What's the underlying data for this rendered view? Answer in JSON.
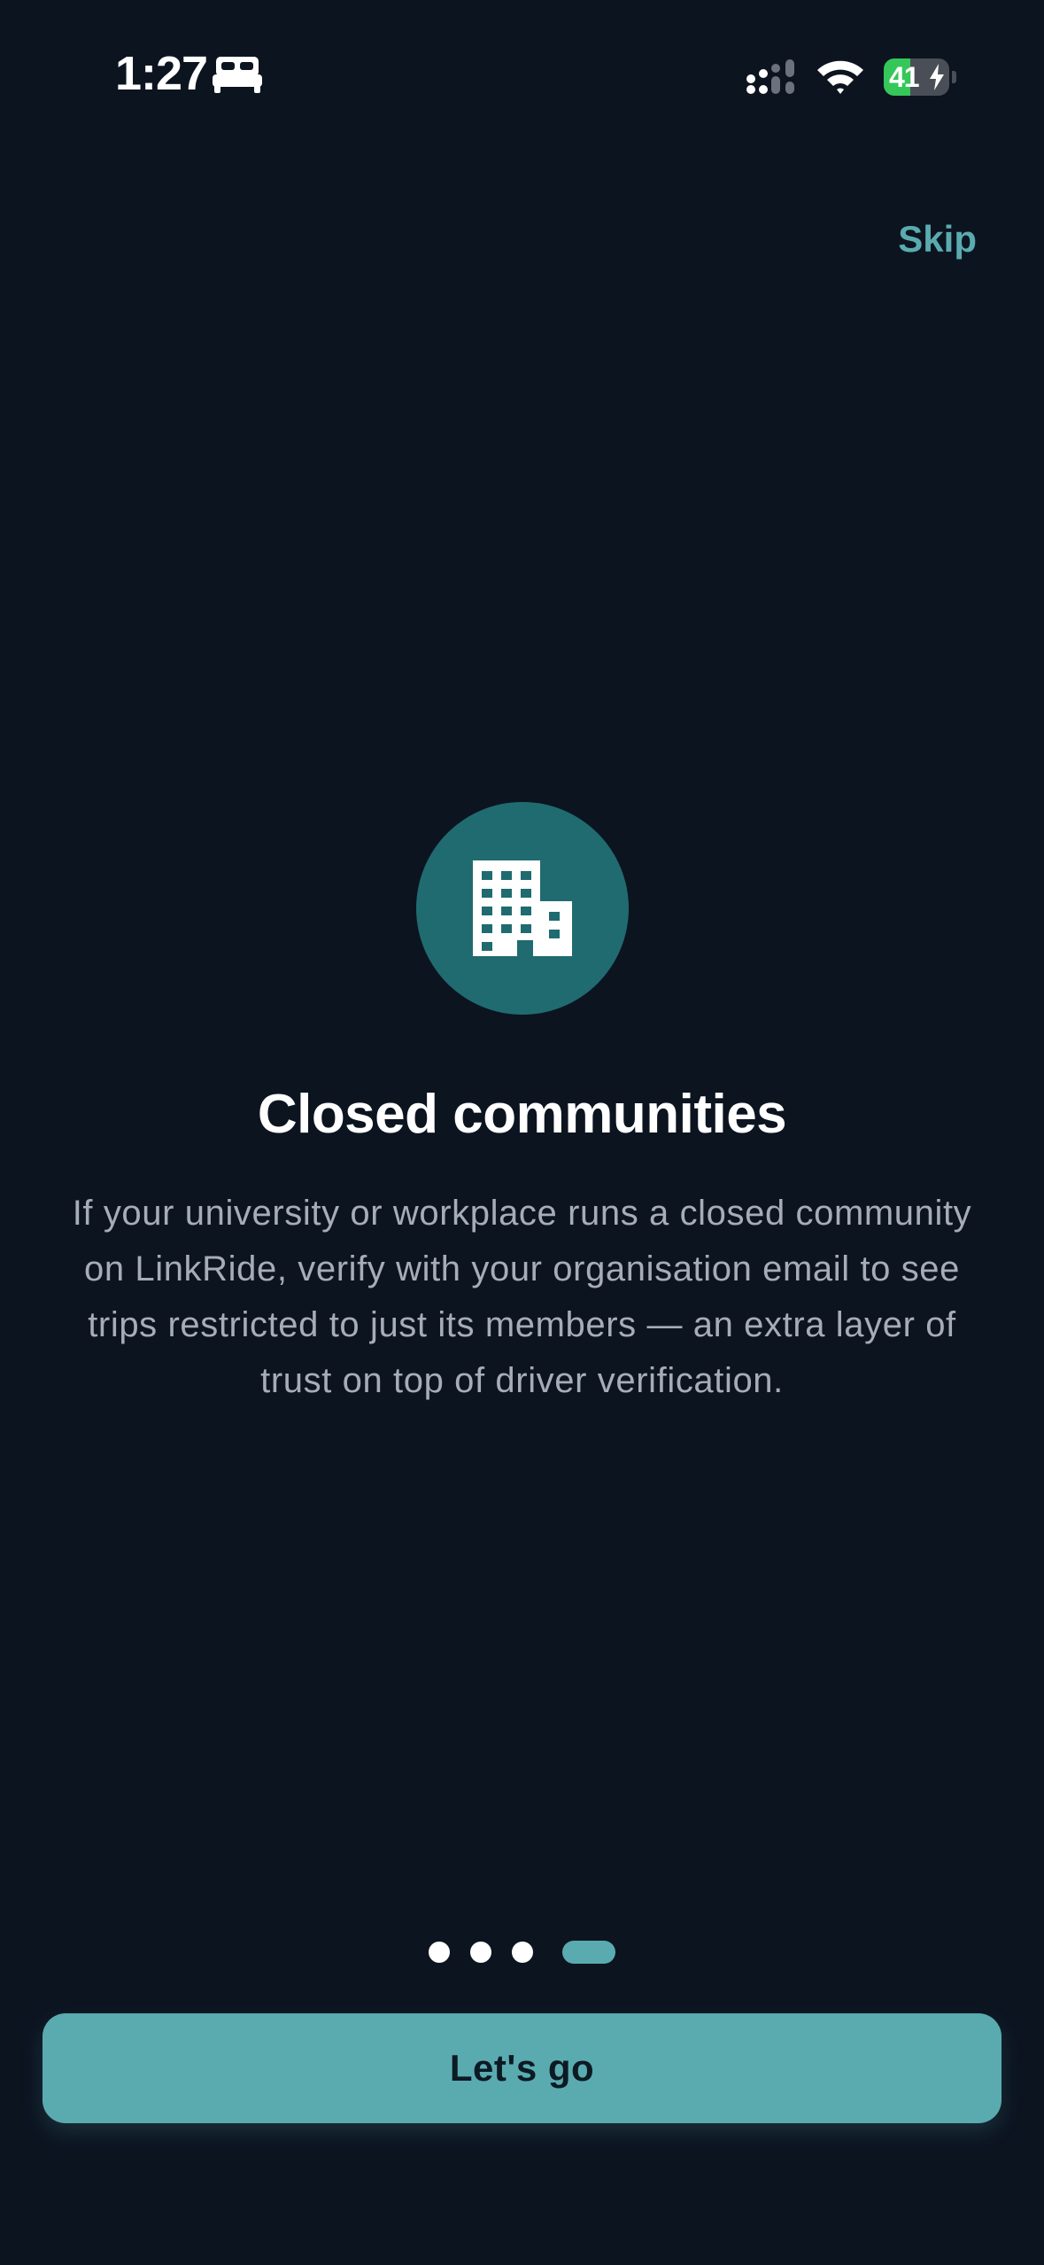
{
  "status_bar": {
    "time": "1:27",
    "battery_level": "41",
    "battery_fraction": 0.41,
    "icons": [
      "bed-icon",
      "signal-icon",
      "wifi-icon",
      "battery-icon",
      "bolt-icon"
    ]
  },
  "header": {
    "skip_label": "Skip"
  },
  "onboarding": {
    "icon": "building-icon",
    "title": "Closed communities",
    "description": "If your university or workplace runs a closed community on LinkRide, verify with your organisation email to see trips restricted to just its members — an extra layer of trust on top of driver verification."
  },
  "pagination": {
    "total_pages": 4,
    "current_page": 4
  },
  "footer": {
    "cta_label": "Let's go"
  },
  "colors": {
    "background": "#0c1420",
    "accent": "#5aabb0",
    "icon_circle": "#1f6b70",
    "text_primary": "#ffffff",
    "text_secondary": "#a6adb8",
    "battery_green": "#35c759"
  }
}
